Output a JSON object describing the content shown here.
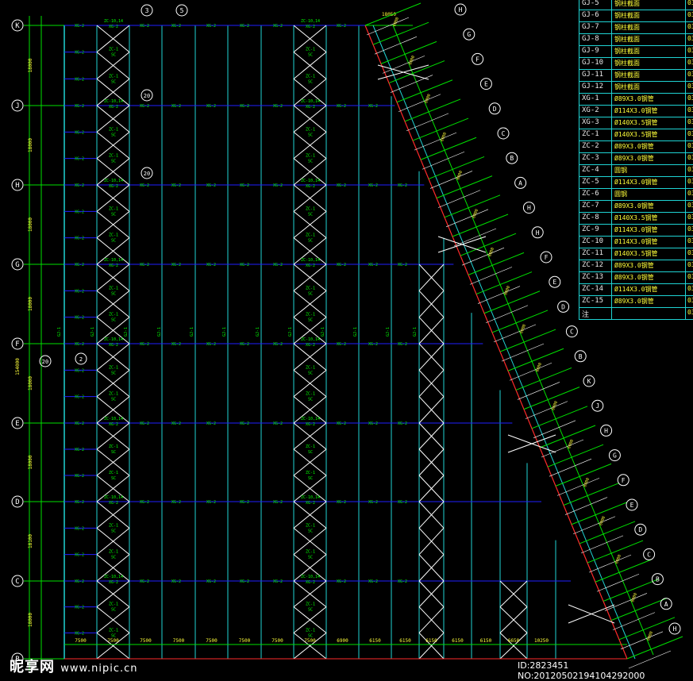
{
  "axis_labels": [
    "K",
    "J",
    "H",
    "G",
    "F",
    "E",
    "D",
    "C",
    "B"
  ],
  "left_dims": [
    "18000",
    "18000",
    "18000",
    "18000",
    "18000",
    "18000",
    "18100",
    "18000"
  ],
  "total_dim": "154000",
  "bottom_dims": [
    "7500",
    "7500",
    "7500",
    "7500",
    "7500",
    "7500",
    "7500",
    "7500",
    "6900",
    "6150",
    "6150",
    "6150",
    "6150",
    "6150",
    "6650",
    "10250"
  ],
  "top_dim": "18050",
  "column_markers": [
    "3",
    "5"
  ],
  "left_markers": [
    "20",
    "20",
    "20",
    "2",
    "20"
  ],
  "member_labels": {
    "purlin": "XG-2",
    "purlin_alt": "XG-1",
    "brace": "ZC-1",
    "column": "GJ-1",
    "tie": "SC",
    "zc_row": "ZC-10,14"
  },
  "diag_axis_labels": [
    "H",
    "G",
    "F",
    "E",
    "D",
    "C",
    "B",
    "A",
    "H",
    "H",
    "F",
    "E",
    "D",
    "C",
    "B",
    "K",
    "J",
    "H",
    "G",
    "F",
    "E",
    "D",
    "C",
    "B",
    "A",
    "H"
  ],
  "diag_dim": "6000",
  "legend": [
    {
      "code": "GJ-5",
      "desc": "钢柱截面"
    },
    {
      "code": "GJ-6",
      "desc": "钢柱截面"
    },
    {
      "code": "GJ-7",
      "desc": "钢柱截面"
    },
    {
      "code": "GJ-8",
      "desc": "钢柱截面"
    },
    {
      "code": "GJ-9",
      "desc": "钢柱截面"
    },
    {
      "code": "GJ-10",
      "desc": "钢柱截面"
    },
    {
      "code": "GJ-11",
      "desc": "钢柱截面"
    },
    {
      "code": "GJ-12",
      "desc": "钢柱截面"
    },
    {
      "code": "XG-1",
      "desc": "Ø89X3.0钢管"
    },
    {
      "code": "XG-2",
      "desc": "Ø114X3.0钢管"
    },
    {
      "code": "XG-3",
      "desc": "Ø140X3.5钢管"
    },
    {
      "code": "ZC-1",
      "desc": "Ø140X3.5钢管"
    },
    {
      "code": "ZC-2",
      "desc": "Ø89X3.0钢管"
    },
    {
      "code": "ZC-3",
      "desc": "Ø89X3.0钢管"
    },
    {
      "code": "ZC-4",
      "desc": "圆钢"
    },
    {
      "code": "ZC-5",
      "desc": "Ø114X3.0钢管"
    },
    {
      "code": "ZC-6",
      "desc": "圆钢"
    },
    {
      "code": "ZC-7",
      "desc": "Ø89X3.0钢管"
    },
    {
      "code": "ZC-8",
      "desc": "Ø140X3.5钢管"
    },
    {
      "code": "ZC-9",
      "desc": "Ø114X3.0钢管"
    },
    {
      "code": "ZC-10",
      "desc": "Ø114X3.0钢管"
    },
    {
      "code": "ZC-11",
      "desc": "Ø140X3.5钢管"
    },
    {
      "code": "ZC-12",
      "desc": "Ø89X3.0钢管"
    },
    {
      "code": "ZC-13",
      "desc": "Ø89X3.0钢管"
    },
    {
      "code": "ZC-14",
      "desc": "Ø114X3.0钢管"
    },
    {
      "code": "ZC-15",
      "desc": "Ø89X3.0钢管"
    },
    {
      "code": "注",
      "desc": ""
    }
  ],
  "legend_ref": "03",
  "watermark": {
    "brand": "昵享网",
    "url": "www.nipic.cn"
  },
  "image_id": "ID:2823451 NO:20120502194104292000",
  "colors": {
    "axis": "#1fd3d3",
    "beam": "#2020ff",
    "green": "#00e000",
    "text": "#00ff00",
    "red": "#ff2a2a",
    "white": "#ffffff",
    "yellow": "#ffff3a"
  }
}
